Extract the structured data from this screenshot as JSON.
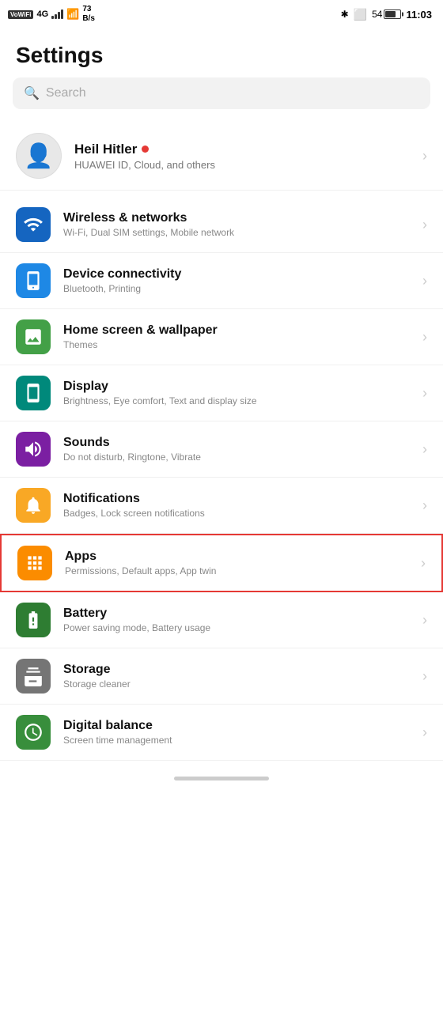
{
  "statusBar": {
    "left": {
      "vowifi": "VoWiFi",
      "signal4g": "4G",
      "wifi": "WiFi",
      "speed": "73 B/s"
    },
    "right": {
      "bluetooth": "✱",
      "vibrate": "📳",
      "battery": "54",
      "time": "11:03"
    }
  },
  "pageTitle": "Settings",
  "search": {
    "placeholder": "Search"
  },
  "profile": {
    "name": "Heil Hitler",
    "subtitle": "HUAWEI ID, Cloud, and others"
  },
  "settingsItems": [
    {
      "id": "wireless",
      "iconColor": "icon-blue",
      "iconSymbol": "📶",
      "title": "Wireless & networks",
      "subtitle": "Wi-Fi, Dual SIM settings, Mobile network",
      "highlighted": false
    },
    {
      "id": "device-connectivity",
      "iconColor": "icon-blue2",
      "iconSymbol": "📱",
      "title": "Device connectivity",
      "subtitle": "Bluetooth, Printing",
      "highlighted": false
    },
    {
      "id": "home-screen",
      "iconColor": "icon-green",
      "iconSymbol": "🖼",
      "title": "Home screen & wallpaper",
      "subtitle": "Themes",
      "highlighted": false
    },
    {
      "id": "display",
      "iconColor": "icon-teal",
      "iconSymbol": "📱",
      "title": "Display",
      "subtitle": "Brightness, Eye comfort, Text and display size",
      "highlighted": false
    },
    {
      "id": "sounds",
      "iconColor": "icon-purple",
      "iconSymbol": "🔊",
      "title": "Sounds",
      "subtitle": "Do not disturb, Ringtone, Vibrate",
      "highlighted": false
    },
    {
      "id": "notifications",
      "iconColor": "icon-yellow",
      "iconSymbol": "🔔",
      "title": "Notifications",
      "subtitle": "Badges, Lock screen notifications",
      "highlighted": false
    },
    {
      "id": "apps",
      "iconColor": "icon-orange",
      "iconSymbol": "⊞",
      "title": "Apps",
      "subtitle": "Permissions, Default apps, App twin",
      "highlighted": true
    },
    {
      "id": "battery",
      "iconColor": "icon-green2",
      "iconSymbol": "🔋",
      "title": "Battery",
      "subtitle": "Power saving mode, Battery usage",
      "highlighted": false
    },
    {
      "id": "storage",
      "iconColor": "icon-gray",
      "iconSymbol": "☰",
      "title": "Storage",
      "subtitle": "Storage cleaner",
      "highlighted": false
    },
    {
      "id": "digital-balance",
      "iconColor": "icon-green3",
      "iconSymbol": "⧗",
      "title": "Digital balance",
      "subtitle": "Screen time management",
      "highlighted": false
    }
  ]
}
